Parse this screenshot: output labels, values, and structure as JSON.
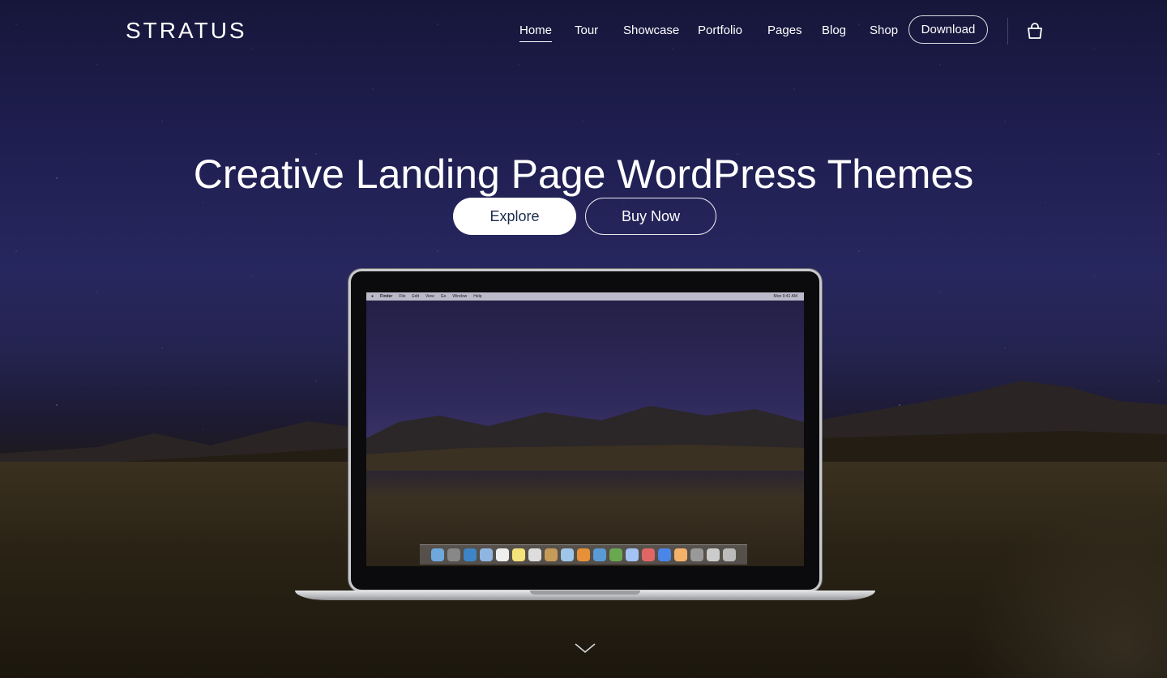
{
  "brand": {
    "name": "STRATUS"
  },
  "nav": {
    "items": [
      {
        "label": "Home",
        "active": true
      },
      {
        "label": "Tour"
      },
      {
        "label": "Showcase"
      },
      {
        "label": "Portfolio"
      },
      {
        "label": "Pages"
      },
      {
        "label": "Blog"
      },
      {
        "label": "Shop"
      }
    ],
    "download_label": "Download",
    "cart_icon": "shopping-bag-icon"
  },
  "hero": {
    "title": "Creative Landing Page WordPress Themes",
    "primary_button": "Explore",
    "secondary_button": "Buy Now",
    "scroll_icon": "chevron-down-icon"
  },
  "laptop_screen": {
    "menubar_items": [
      "Finder",
      "File",
      "Edit",
      "View",
      "Go",
      "Window",
      "Help"
    ],
    "clock": "Mon 9:41 AM"
  },
  "colors": {
    "sky_top": "#17163a",
    "ground": "#1e190f",
    "explore_text": "#1a2b4d"
  }
}
